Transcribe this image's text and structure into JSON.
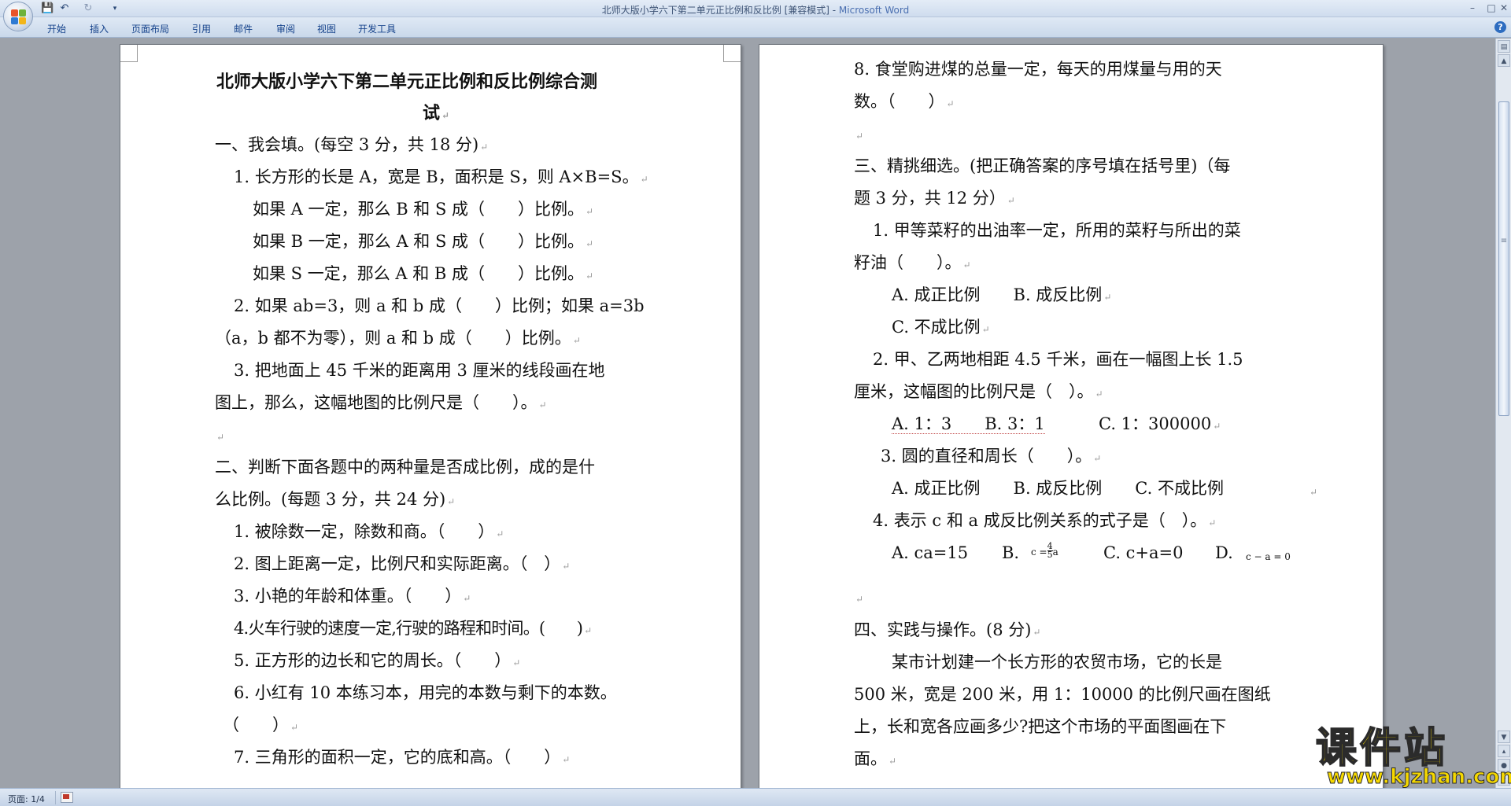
{
  "window": {
    "title": "北师大版小学六下第二单元正比例和反比例 [兼容模式] - ",
    "app_name": "Microsoft Word",
    "minimize": "–",
    "maximize": "□",
    "close": "✕"
  },
  "quick_access": {
    "save": "💾",
    "undo": "↶",
    "redo": "↻",
    "customize": "▾"
  },
  "ribbon": {
    "tabs": [
      "开始",
      "插入",
      "页面布局",
      "引用",
      "邮件",
      "审阅",
      "视图",
      "开发工具"
    ],
    "help": "?"
  },
  "left_page": {
    "title_line1": "北师大版小学六下第二单元正比例和反比例综合测",
    "title_line2": "试",
    "lines": [
      "一、我会填。(每空 3 分，共 18 分)",
      "1. 长方形的长是 A，宽是 B，面积是 S，则 A×B=S。",
      "如果 A 一定，那么 B 和 S 成（　　）比例。",
      "如果 B 一定，那么 A 和 S 成（　　）比例。",
      "如果 S 一定，那么 A 和 B 成（　　）比例。",
      "2. 如果 ab=3，则 a 和 b 成（　　）比例；如果 a=3b",
      "（a，b 都不为零），则 a 和 b 成（　　）比例。",
      "3. 把地面上 45 千米的距离用 3 厘米的线段画在地",
      "图上，那么，这幅地图的比例尺是（　　）。",
      "",
      "二、判断下面各题中的两种量是否成比例，成的是什",
      "么比例。(每题 3 分，共 24 分)",
      "1. 被除数一定，除数和商。（　　）",
      "2. 图上距离一定，比例尺和实际距离。（　）",
      "3. 小艳的年龄和体重。（　　）",
      "4.火车行驶的速度一定,行驶的路程和时间。(　　)",
      "5. 正方形的边长和它的周长。（　　）",
      "6. 小红有 10 本练习本，用完的本数与剩下的本数。",
      "（　　）",
      "7. 三角形的面积一定，它的底和高。（　　）"
    ]
  },
  "right_page": {
    "lines": [
      "8. 食堂购进煤的总量一定，每天的用煤量与用的天",
      "数。（　　）",
      "",
      "三、精挑细选。(把正确答案的序号填在括号里)（每",
      "题 3 分，共 12 分）",
      "1. 甲等菜籽的出油率一定，所用的菜籽与所出的菜",
      "籽油（　　）。",
      "A. 成正比例　　B. 成反比例",
      "C. 不成比例",
      "2. 甲、乙两地相距 4.5 千米，画在一幅图上长 1.5",
      "厘米，这幅图的比例尺是（　）。",
      "A. 1：3　　B. 3：1",
      "C. 1：300000",
      "3. 圆的直径和周长（　　）。",
      "A. 成正比例　　B. 成反比例　　C. 不成比例",
      "4. 表示 c 和 a 成反比例关系的式子是（　）。",
      "A. ca=15",
      "B.",
      "c =",
      "4",
      "5",
      "a",
      "C. c+a=0",
      "D.",
      "c − a = 0",
      "",
      "四、实践与操作。(8 分)",
      "某市计划建一个长方形的农贸市场，它的长是",
      "500 米，宽是 200 米，用 1：10000 的比例尺画在图纸",
      "上，长和宽各应画多少?把这个市场的平面图画在下",
      "面。"
    ]
  },
  "status_bar": {
    "page_indicator": "页面: 1/4"
  },
  "watermark": {
    "cn": "课件站",
    "url": "www.kjzhan.com"
  },
  "paragraph_mark": "↵",
  "colors": {
    "workspace": "#9da2aa",
    "ribbon_text": "#15428b",
    "watermark": "#f5d800"
  }
}
